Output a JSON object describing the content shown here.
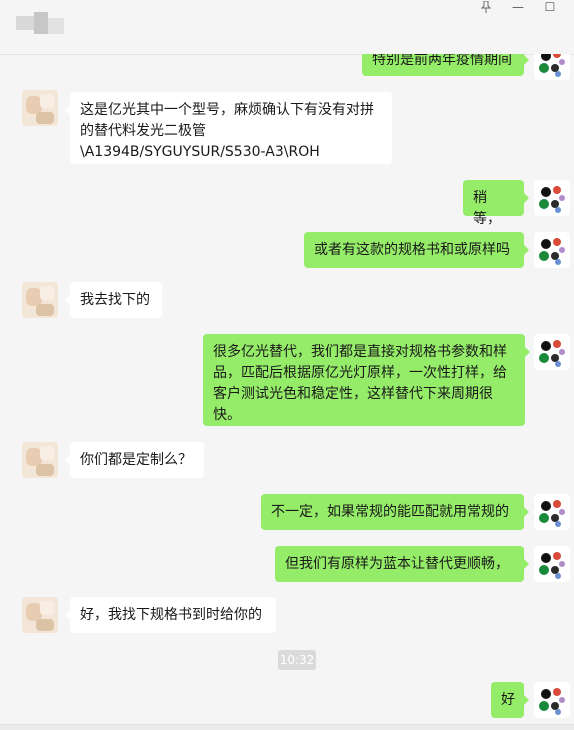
{
  "window": {
    "pin_icon": "pin-icon",
    "minimize_label": "—",
    "maximize_label": "☐"
  },
  "messages": [
    {
      "sender": "self",
      "text": "特别是前两年疫情期间"
    },
    {
      "sender": "other",
      "text": "这是亿光其中一个型号，麻烦确认下有没有对拼的替代料发光二极管\\A1394B/SYGUYSUR/S530-A3\\ROH"
    },
    {
      "sender": "self",
      "text": "稍等，"
    },
    {
      "sender": "self",
      "text": "或者有这款的规格书和或原样吗"
    },
    {
      "sender": "other",
      "text": "我去找下的"
    },
    {
      "sender": "self",
      "text": "很多亿光替代，我们都是直接对规格书参数和样品，匹配后根据原亿光灯原样，一次性打样，给客户测试光色和稳定性，这样替代下来周期很快。"
    },
    {
      "sender": "other",
      "text": "你们都是定制么？"
    },
    {
      "sender": "self",
      "text": "不一定，如果常规的能匹配就用常规的"
    },
    {
      "sender": "self",
      "text": "但我们有原样为蓝本让替代更顺畅，"
    },
    {
      "sender": "other",
      "text": "好，我找下规格书到时给你的"
    },
    {
      "sender": "self",
      "text": "好"
    }
  ],
  "timestamp": "10:32",
  "colors": {
    "self_bubble": "#95ec69",
    "other_bubble": "#ffffff",
    "background": "#f5f5f5"
  }
}
